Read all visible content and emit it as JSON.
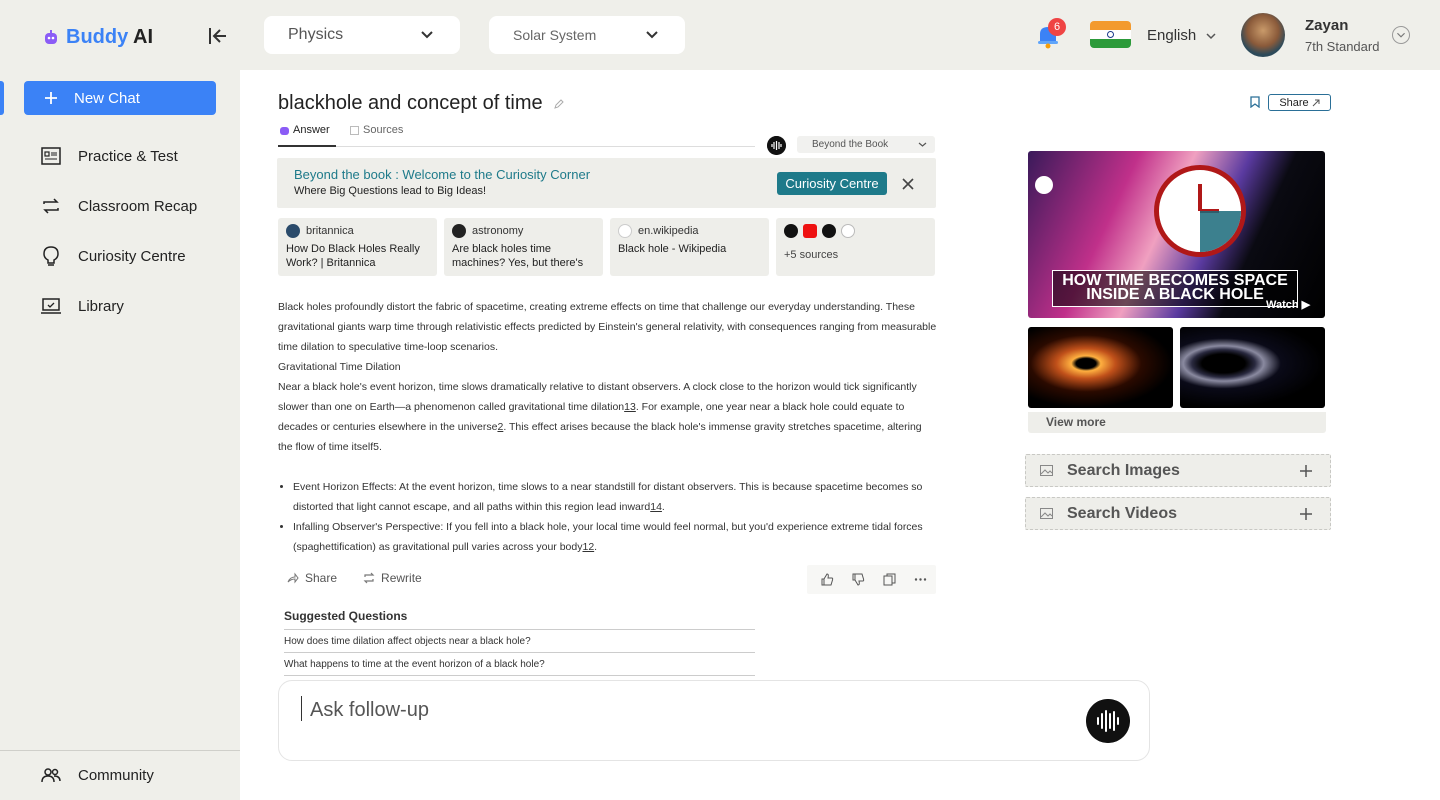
{
  "header": {
    "logo_buddy": "Buddy",
    "logo_ai": "AI",
    "subject": "Physics",
    "topic": "Solar System",
    "notifications": "6",
    "language": "English",
    "user_name": "Zayan",
    "user_class": "7th Standard"
  },
  "sidebar": {
    "new_chat": "New Chat",
    "items": [
      {
        "label": "Practice & Test",
        "icon": "practice-icon"
      },
      {
        "label": "Classroom Recap",
        "icon": "recap-icon"
      },
      {
        "label": "Curiosity Centre",
        "icon": "bulb-icon"
      },
      {
        "label": "Library",
        "icon": "laptop-icon"
      }
    ],
    "community": "Community"
  },
  "chat": {
    "title": "blackhole and concept of time",
    "share": "Share",
    "tab_answer": "Answer",
    "tab_sources": "Sources",
    "mode": "Beyond the Book",
    "banner_title": "Beyond the book : Welcome to the Curiosity Corner",
    "banner_sub": "Where Big Questions lead to Big Ideas!",
    "banner_button": "Curiosity Centre",
    "sources": [
      {
        "site": "britannica",
        "title": "How Do Black Holes Really Work? | Britannica"
      },
      {
        "site": "astronomy",
        "title": "Are black holes time machines? Yes, but there's ..."
      },
      {
        "site": "en.wikipedia",
        "title": "Black hole - Wikipedia"
      }
    ],
    "more_sources": "+5 sources",
    "para1": "Black holes profoundly distort the fabric of spacetime, creating extreme effects on time that challenge our everyday understanding. These gravitational giants warp time through relativistic effects predicted by Einstein's general relativity, with consequences ranging from measurable time dilation to speculative time-loop scenarios.",
    "heading": "Gravitational Time Dilation",
    "para2_a": "Near a black hole's event horizon, time slows dramatically relative to distant observers. A clock close to the horizon would tick significantly slower than one on Earth—a phenomenon called gravitational time dilation",
    "para2_ref1": "13",
    "para2_b": ". For example, one year near a black hole could equate to decades or centuries elsewhere in the universe",
    "para2_ref2": "2",
    "para2_c": ". This effect arises because the black hole's immense gravity stretches spacetime, altering the flow of time itself5.",
    "bullet1": "Event Horizon Effects: At the event horizon, time slows to a near standstill for distant observers. This is because spacetime becomes so distorted that light cannot escape, and all paths within this region lead inward",
    "bullet1_ref": "14",
    "bullet2": "Infalling Observer's Perspective: If you fell into a black hole, your local time would feel normal, but you'd experience extreme tidal forces (spaghettification) as gravitational pull varies across your body",
    "bullet2_ref": "12",
    "action_share": "Share",
    "action_rewrite": "Rewrite",
    "suggested_title": "Suggested Questions",
    "suggested": [
      "How does time dilation affect objects near a black hole?",
      "What happens to time at the event horizon of a black hole?"
    ],
    "ask_placeholder": "Ask follow-up"
  },
  "media": {
    "video_caption_1": "HOW TIME BECOMES SPACE",
    "video_caption_2": "INSIDE A BLACK HOLE",
    "watch": "Watch",
    "view_more": "View more",
    "search_images": "Search Images",
    "search_videos": "Search Videos"
  },
  "colors": {
    "accent": "#3b82f6",
    "teal": "#1e7a8a",
    "sidebar_bg": "#efefea"
  }
}
